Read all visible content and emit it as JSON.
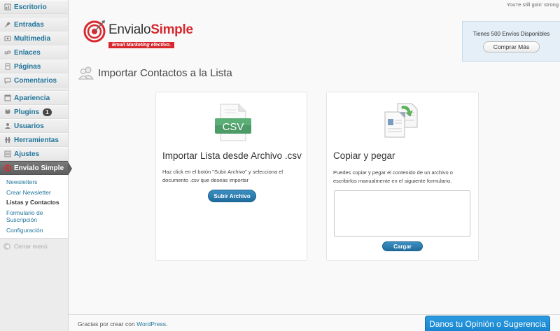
{
  "sidebar": {
    "items": [
      {
        "label": "Escritorio",
        "icon": "dashboard-icon"
      },
      {
        "label": "Entradas",
        "icon": "pin-icon"
      },
      {
        "label": "Multimedia",
        "icon": "media-icon"
      },
      {
        "label": "Enlaces",
        "icon": "link-icon"
      },
      {
        "label": "Páginas",
        "icon": "page-icon"
      },
      {
        "label": "Comentarios",
        "icon": "comment-icon"
      },
      {
        "label": "Apariencia",
        "icon": "appearance-icon"
      },
      {
        "label": "Plugins",
        "icon": "plugin-icon",
        "badge": "1"
      },
      {
        "label": "Usuarios",
        "icon": "users-icon"
      },
      {
        "label": "Herramientas",
        "icon": "tools-icon"
      },
      {
        "label": "Ajustes",
        "icon": "settings-icon"
      },
      {
        "label": "Envialo Simple",
        "icon": "envialo-icon"
      }
    ],
    "submenu": [
      "Newsletters",
      "Crear Newsletter",
      "Listas y Contactos",
      "Formulario de Suscripción",
      "Configuración"
    ],
    "collapse_label": "Cerrar menú"
  },
  "header": {
    "greeting": "You're still goin' strong",
    "logo_brand_1": "Envialo",
    "logo_brand_2": "Simple",
    "logo_tagline": "Email Marketing efectivo.",
    "sends_text": "Tienes 500 Envíos Disponibles",
    "buy_more_label": "Comprar Más"
  },
  "page": {
    "title": "Importar Contactos a la Lista"
  },
  "csv_panel": {
    "icon_text": "CSV",
    "title": "Importar Lista desde Archivo .csv",
    "description": "Haz click en el botón \"Subir Archivo\" y selecciona el documento .csv que deseas importar",
    "button_label": "Subir Archivo"
  },
  "paste_panel": {
    "title": "Copiar y pegar",
    "description": "Puedes copiar y pegar el contenido de un archivo o escribirlos manualmente en el siguiente formulario.",
    "textarea_value": "",
    "button_label": "Cargar"
  },
  "footer": {
    "text": "Gracias por crear con",
    "link": "WordPress",
    "period": ".",
    "feedback_label": "Danos tu Opinión o Sugerencia"
  },
  "colors": {
    "brand_red": "#d7282f",
    "button_blue": "#1f6d9f",
    "link_blue": "#21759b",
    "feedback_blue": "#1a86cf"
  }
}
